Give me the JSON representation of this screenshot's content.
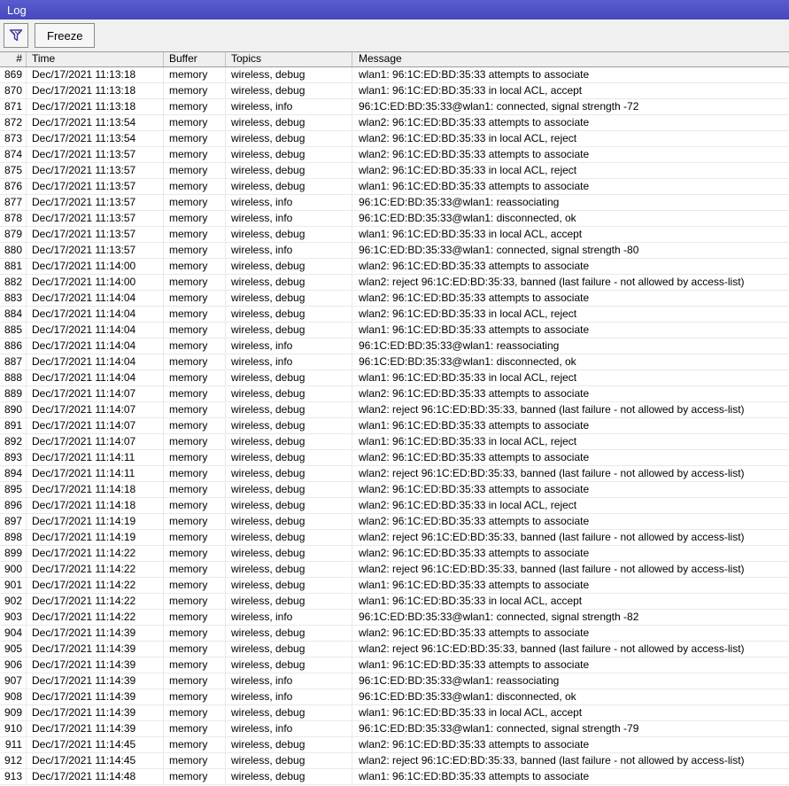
{
  "window": {
    "title": "Log"
  },
  "toolbar": {
    "freeze_label": "Freeze"
  },
  "colors": {
    "titlebar_top": "#5a5cce",
    "titlebar_bottom": "#4649bb",
    "toolbar_bg": "#f0f0f0",
    "header_bg": "#efefef",
    "row_border": "#e9e9e9",
    "icon_blue": "#3c3c9c"
  },
  "table": {
    "columns": [
      "#",
      "Time",
      "Buffer",
      "Topics",
      "Message"
    ],
    "rows": [
      {
        "id": "869",
        "time": "Dec/17/2021 11:13:18",
        "buffer": "memory",
        "topics": "wireless, debug",
        "message": "wlan1: 96:1C:ED:BD:35:33 attempts to associate"
      },
      {
        "id": "870",
        "time": "Dec/17/2021 11:13:18",
        "buffer": "memory",
        "topics": "wireless, debug",
        "message": "wlan1: 96:1C:ED:BD:35:33 in local ACL, accept"
      },
      {
        "id": "871",
        "time": "Dec/17/2021 11:13:18",
        "buffer": "memory",
        "topics": "wireless, info",
        "message": "96:1C:ED:BD:35:33@wlan1: connected, signal strength -72"
      },
      {
        "id": "872",
        "time": "Dec/17/2021 11:13:54",
        "buffer": "memory",
        "topics": "wireless, debug",
        "message": "wlan2: 96:1C:ED:BD:35:33 attempts to associate"
      },
      {
        "id": "873",
        "time": "Dec/17/2021 11:13:54",
        "buffer": "memory",
        "topics": "wireless, debug",
        "message": "wlan2: 96:1C:ED:BD:35:33 in local ACL, reject"
      },
      {
        "id": "874",
        "time": "Dec/17/2021 11:13:57",
        "buffer": "memory",
        "topics": "wireless, debug",
        "message": "wlan2: 96:1C:ED:BD:35:33 attempts to associate"
      },
      {
        "id": "875",
        "time": "Dec/17/2021 11:13:57",
        "buffer": "memory",
        "topics": "wireless, debug",
        "message": "wlan2: 96:1C:ED:BD:35:33 in local ACL, reject"
      },
      {
        "id": "876",
        "time": "Dec/17/2021 11:13:57",
        "buffer": "memory",
        "topics": "wireless, debug",
        "message": "wlan1: 96:1C:ED:BD:35:33 attempts to associate"
      },
      {
        "id": "877",
        "time": "Dec/17/2021 11:13:57",
        "buffer": "memory",
        "topics": "wireless, info",
        "message": "96:1C:ED:BD:35:33@wlan1: reassociating"
      },
      {
        "id": "878",
        "time": "Dec/17/2021 11:13:57",
        "buffer": "memory",
        "topics": "wireless, info",
        "message": "96:1C:ED:BD:35:33@wlan1: disconnected, ok"
      },
      {
        "id": "879",
        "time": "Dec/17/2021 11:13:57",
        "buffer": "memory",
        "topics": "wireless, debug",
        "message": "wlan1: 96:1C:ED:BD:35:33 in local ACL, accept"
      },
      {
        "id": "880",
        "time": "Dec/17/2021 11:13:57",
        "buffer": "memory",
        "topics": "wireless, info",
        "message": "96:1C:ED:BD:35:33@wlan1: connected, signal strength -80"
      },
      {
        "id": "881",
        "time": "Dec/17/2021 11:14:00",
        "buffer": "memory",
        "topics": "wireless, debug",
        "message": "wlan2: 96:1C:ED:BD:35:33 attempts to associate"
      },
      {
        "id": "882",
        "time": "Dec/17/2021 11:14:00",
        "buffer": "memory",
        "topics": "wireless, debug",
        "message": "wlan2: reject 96:1C:ED:BD:35:33, banned (last failure - not allowed by access-list)"
      },
      {
        "id": "883",
        "time": "Dec/17/2021 11:14:04",
        "buffer": "memory",
        "topics": "wireless, debug",
        "message": "wlan2: 96:1C:ED:BD:35:33 attempts to associate"
      },
      {
        "id": "884",
        "time": "Dec/17/2021 11:14:04",
        "buffer": "memory",
        "topics": "wireless, debug",
        "message": "wlan2: 96:1C:ED:BD:35:33 in local ACL, reject"
      },
      {
        "id": "885",
        "time": "Dec/17/2021 11:14:04",
        "buffer": "memory",
        "topics": "wireless, debug",
        "message": "wlan1: 96:1C:ED:BD:35:33 attempts to associate"
      },
      {
        "id": "886",
        "time": "Dec/17/2021 11:14:04",
        "buffer": "memory",
        "topics": "wireless, info",
        "message": "96:1C:ED:BD:35:33@wlan1: reassociating"
      },
      {
        "id": "887",
        "time": "Dec/17/2021 11:14:04",
        "buffer": "memory",
        "topics": "wireless, info",
        "message": "96:1C:ED:BD:35:33@wlan1: disconnected, ok"
      },
      {
        "id": "888",
        "time": "Dec/17/2021 11:14:04",
        "buffer": "memory",
        "topics": "wireless, debug",
        "message": "wlan1: 96:1C:ED:BD:35:33 in local ACL, reject"
      },
      {
        "id": "889",
        "time": "Dec/17/2021 11:14:07",
        "buffer": "memory",
        "topics": "wireless, debug",
        "message": "wlan2: 96:1C:ED:BD:35:33 attempts to associate"
      },
      {
        "id": "890",
        "time": "Dec/17/2021 11:14:07",
        "buffer": "memory",
        "topics": "wireless, debug",
        "message": "wlan2: reject 96:1C:ED:BD:35:33, banned (last failure - not allowed by access-list)"
      },
      {
        "id": "891",
        "time": "Dec/17/2021 11:14:07",
        "buffer": "memory",
        "topics": "wireless, debug",
        "message": "wlan1: 96:1C:ED:BD:35:33 attempts to associate"
      },
      {
        "id": "892",
        "time": "Dec/17/2021 11:14:07",
        "buffer": "memory",
        "topics": "wireless, debug",
        "message": "wlan1: 96:1C:ED:BD:35:33 in local ACL, reject"
      },
      {
        "id": "893",
        "time": "Dec/17/2021 11:14:11",
        "buffer": "memory",
        "topics": "wireless, debug",
        "message": "wlan2: 96:1C:ED:BD:35:33 attempts to associate"
      },
      {
        "id": "894",
        "time": "Dec/17/2021 11:14:11",
        "buffer": "memory",
        "topics": "wireless, debug",
        "message": "wlan2: reject 96:1C:ED:BD:35:33, banned (last failure - not allowed by access-list)"
      },
      {
        "id": "895",
        "time": "Dec/17/2021 11:14:18",
        "buffer": "memory",
        "topics": "wireless, debug",
        "message": "wlan2: 96:1C:ED:BD:35:33 attempts to associate"
      },
      {
        "id": "896",
        "time": "Dec/17/2021 11:14:18",
        "buffer": "memory",
        "topics": "wireless, debug",
        "message": "wlan2: 96:1C:ED:BD:35:33 in local ACL, reject"
      },
      {
        "id": "897",
        "time": "Dec/17/2021 11:14:19",
        "buffer": "memory",
        "topics": "wireless, debug",
        "message": "wlan2: 96:1C:ED:BD:35:33 attempts to associate"
      },
      {
        "id": "898",
        "time": "Dec/17/2021 11:14:19",
        "buffer": "memory",
        "topics": "wireless, debug",
        "message": "wlan2: reject 96:1C:ED:BD:35:33, banned (last failure - not allowed by access-list)"
      },
      {
        "id": "899",
        "time": "Dec/17/2021 11:14:22",
        "buffer": "memory",
        "topics": "wireless, debug",
        "message": "wlan2: 96:1C:ED:BD:35:33 attempts to associate"
      },
      {
        "id": "900",
        "time": "Dec/17/2021 11:14:22",
        "buffer": "memory",
        "topics": "wireless, debug",
        "message": "wlan2: reject 96:1C:ED:BD:35:33, banned (last failure - not allowed by access-list)"
      },
      {
        "id": "901",
        "time": "Dec/17/2021 11:14:22",
        "buffer": "memory",
        "topics": "wireless, debug",
        "message": "wlan1: 96:1C:ED:BD:35:33 attempts to associate"
      },
      {
        "id": "902",
        "time": "Dec/17/2021 11:14:22",
        "buffer": "memory",
        "topics": "wireless, debug",
        "message": "wlan1: 96:1C:ED:BD:35:33 in local ACL, accept"
      },
      {
        "id": "903",
        "time": "Dec/17/2021 11:14:22",
        "buffer": "memory",
        "topics": "wireless, info",
        "message": "96:1C:ED:BD:35:33@wlan1: connected, signal strength -82"
      },
      {
        "id": "904",
        "time": "Dec/17/2021 11:14:39",
        "buffer": "memory",
        "topics": "wireless, debug",
        "message": "wlan2: 96:1C:ED:BD:35:33 attempts to associate"
      },
      {
        "id": "905",
        "time": "Dec/17/2021 11:14:39",
        "buffer": "memory",
        "topics": "wireless, debug",
        "message": "wlan2: reject 96:1C:ED:BD:35:33, banned (last failure - not allowed by access-list)"
      },
      {
        "id": "906",
        "time": "Dec/17/2021 11:14:39",
        "buffer": "memory",
        "topics": "wireless, debug",
        "message": "wlan1: 96:1C:ED:BD:35:33 attempts to associate"
      },
      {
        "id": "907",
        "time": "Dec/17/2021 11:14:39",
        "buffer": "memory",
        "topics": "wireless, info",
        "message": "96:1C:ED:BD:35:33@wlan1: reassociating"
      },
      {
        "id": "908",
        "time": "Dec/17/2021 11:14:39",
        "buffer": "memory",
        "topics": "wireless, info",
        "message": "96:1C:ED:BD:35:33@wlan1: disconnected, ok"
      },
      {
        "id": "909",
        "time": "Dec/17/2021 11:14:39",
        "buffer": "memory",
        "topics": "wireless, debug",
        "message": "wlan1: 96:1C:ED:BD:35:33 in local ACL, accept"
      },
      {
        "id": "910",
        "time": "Dec/17/2021 11:14:39",
        "buffer": "memory",
        "topics": "wireless, info",
        "message": "96:1C:ED:BD:35:33@wlan1: connected, signal strength -79"
      },
      {
        "id": "911",
        "time": "Dec/17/2021 11:14:45",
        "buffer": "memory",
        "topics": "wireless, debug",
        "message": "wlan2: 96:1C:ED:BD:35:33 attempts to associate"
      },
      {
        "id": "912",
        "time": "Dec/17/2021 11:14:45",
        "buffer": "memory",
        "topics": "wireless, debug",
        "message": "wlan2: reject 96:1C:ED:BD:35:33, banned (last failure - not allowed by access-list)"
      },
      {
        "id": "913",
        "time": "Dec/17/2021 11:14:48",
        "buffer": "memory",
        "topics": "wireless, debug",
        "message": "wlan1: 96:1C:ED:BD:35:33 attempts to associate"
      }
    ]
  }
}
